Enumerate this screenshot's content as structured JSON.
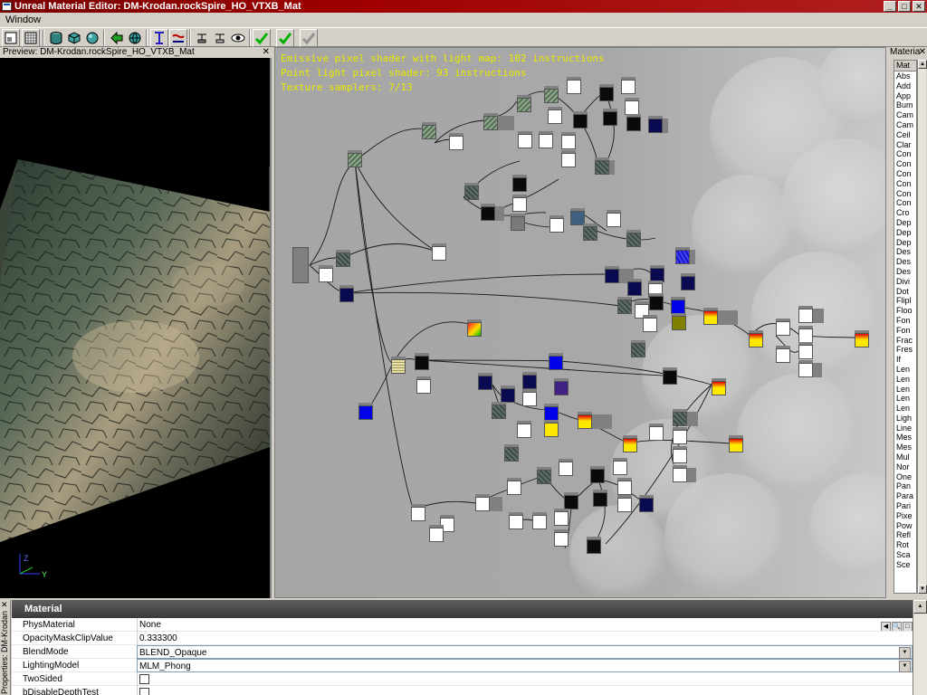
{
  "window": {
    "title": "Unreal Material Editor: DM-Krodan.rockSpire_HO_VTXB_Mat",
    "minimize": "_",
    "maximize": "□",
    "close": "✕"
  },
  "menu": {
    "items": [
      "Window"
    ]
  },
  "preview": {
    "title": "Preview: DM-Krodan.rockSpire_HO_VTXB_Mat",
    "close": "✕",
    "axis_z": "Z",
    "axis_y": "Y"
  },
  "graph": {
    "stats": [
      "Emissive pixel shader with light map: 102 instructions",
      "Point light pixel shader: 93 instructions",
      "Texture samplers: 7/13"
    ]
  },
  "materials_panel": {
    "title": "Materia",
    "close": "✕",
    "header": "Mat",
    "items": [
      "Abs",
      "Add",
      "App",
      "Bum",
      "Cam",
      "Cam",
      "Ceil",
      "Clar",
      "Con",
      "Con",
      "Con",
      "Con",
      "Con",
      "Con",
      "Cro",
      "Dep",
      "Dep",
      "Dep",
      "Des",
      "Des",
      "Des",
      "Divi",
      "Dot",
      "Flipl",
      "Floo",
      "Fon",
      "Fon",
      "Frac",
      "Fres",
      "If",
      "Len",
      "Len",
      "Len",
      "Len",
      "Len",
      "Ligh",
      "Line",
      "Mes",
      "Mes",
      "Mul",
      "Nor",
      "One",
      "Pan",
      "Para",
      "Pari",
      "Pixe",
      "Pow",
      "Refl",
      "Rot",
      "Sca",
      "Sce"
    ]
  },
  "properties": {
    "side_label": "Properties: DM-Krodan.",
    "close": "✕",
    "section": "Material",
    "rows": [
      {
        "key": "PhysMaterial",
        "value": "None"
      },
      {
        "key": "OpacityMaskClipValue",
        "value": "0.333300"
      },
      {
        "key": "BlendMode",
        "value": "BLEND_Opaque"
      },
      {
        "key": "LightingModel",
        "value": "MLM_Phong"
      },
      {
        "key": "TwoSided",
        "value": ""
      },
      {
        "key": "bDisableDepthTest",
        "value": ""
      }
    ]
  },
  "colors": {
    "titlebar": "#8c0000",
    "stats_text": "#e8e800",
    "graph_bg": "#a6a6a6",
    "accept_green": "#00b000"
  }
}
